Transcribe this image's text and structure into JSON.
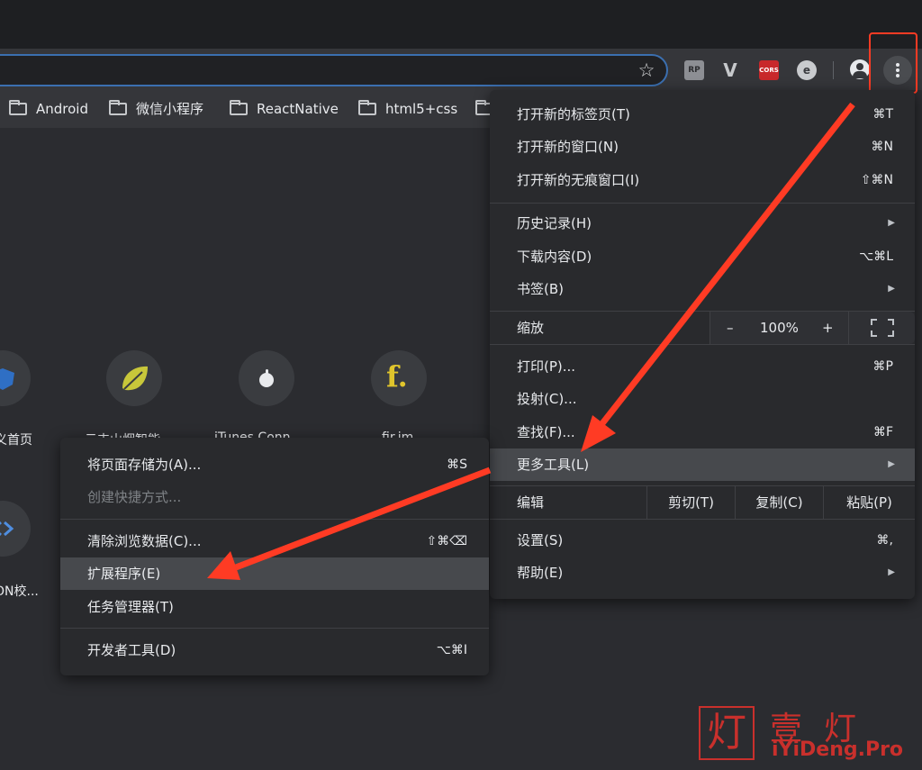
{
  "toolbar": {
    "extensions": [
      "RP",
      "V",
      "CORS",
      "e"
    ]
  },
  "bookmarks": [
    "Android",
    "微信小程序",
    "ReactNative",
    "html5+css"
  ],
  "shortcuts": [
    {
      "label": "义首页"
    },
    {
      "label": "云丰山烟智能"
    },
    {
      "label": "iTunes Conn..."
    },
    {
      "label": "fir.im",
      "glyph": "f."
    },
    {
      "label": "ON校..."
    }
  ],
  "main_menu": {
    "new_tab": {
      "label": "打开新的标签页(T)",
      "shortcut": "⌘T"
    },
    "new_window": {
      "label": "打开新的窗口(N)",
      "shortcut": "⌘N"
    },
    "incognito": {
      "label": "打开新的无痕窗口(I)",
      "shortcut": "⇧⌘N"
    },
    "history": {
      "label": "历史记录(H)"
    },
    "downloads": {
      "label": "下载内容(D)",
      "shortcut": "⌥⌘L"
    },
    "bookmarks": {
      "label": "书签(B)"
    },
    "zoom": {
      "label": "缩放",
      "minus": "–",
      "value": "100%",
      "plus": "+"
    },
    "print": {
      "label": "打印(P)...",
      "shortcut": "⌘P"
    },
    "cast": {
      "label": "投射(C)..."
    },
    "find": {
      "label": "查找(F)...",
      "shortcut": "⌘F"
    },
    "more_tools": {
      "label": "更多工具(L)"
    },
    "edit": {
      "label": "编辑",
      "cut": "剪切(T)",
      "copy": "复制(C)",
      "paste": "粘贴(P)"
    },
    "settings": {
      "label": "设置(S)",
      "shortcut": "⌘,"
    },
    "help": {
      "label": "帮助(E)"
    }
  },
  "sub_menu": {
    "save_page": {
      "label": "将页面存储为(A)...",
      "shortcut": "⌘S"
    },
    "create_shortcut": {
      "label": "创建快捷方式..."
    },
    "clear_data": {
      "label": "清除浏览数据(C)...",
      "shortcut": "⇧⌘⌫"
    },
    "extensions": {
      "label": "扩展程序(E)"
    },
    "task_manager": {
      "label": "任务管理器(T)"
    },
    "dev_tools": {
      "label": "开发者工具(D)",
      "shortcut": "⌥⌘I"
    }
  },
  "watermark": {
    "char": "灯",
    "cn": "壹灯",
    "en": "iYiDeng.Pro"
  },
  "colors": {
    "highlight_red": "#ff3b24",
    "menu_bg": "#292a2d",
    "active_item": "#47494d"
  }
}
